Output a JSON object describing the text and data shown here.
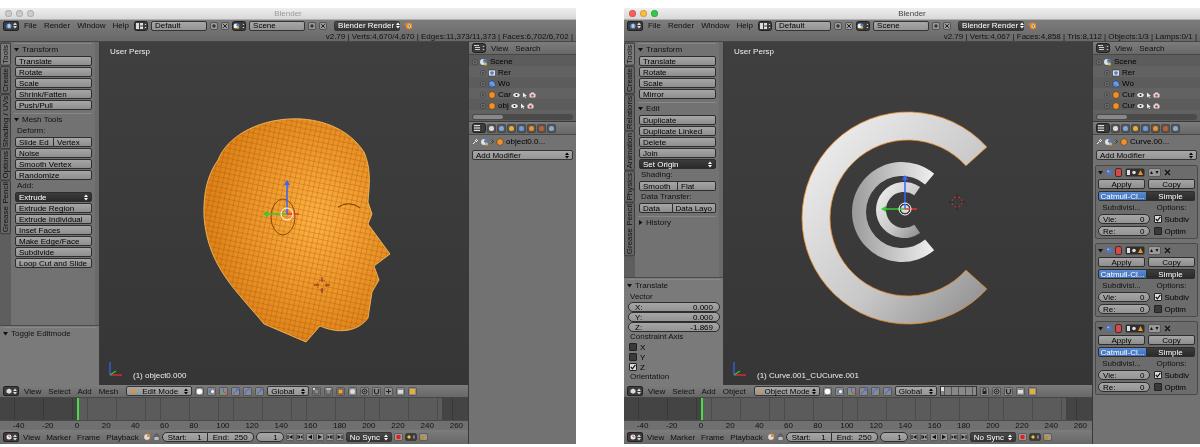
{
  "windows": [
    {
      "title": "Blender",
      "active": false,
      "info_header": {
        "menus": [
          "File",
          "Render",
          "Window",
          "Help"
        ],
        "layout": "Default",
        "scene": "Scene",
        "engine": "Blender Render",
        "stats": "v2.79 | Verts:4,670/4,670 | Edges:11,373/11,373 | Faces:6,702/6,702 |"
      },
      "tool_tabs": [
        {
          "label": "Tools",
          "selected": true
        },
        {
          "label": "Create",
          "selected": false
        },
        {
          "label": "Shading / UVs",
          "selected": false
        },
        {
          "label": "Options",
          "selected": false
        },
        {
          "label": "Grease Pencil",
          "selected": false
        }
      ],
      "tool_panels": [
        {
          "title": "Transform",
          "expanded": true,
          "items": [
            {
              "kind": "button",
              "label": "Translate"
            },
            {
              "kind": "button",
              "label": "Rotate"
            },
            {
              "kind": "button",
              "label": "Scale"
            },
            {
              "kind": "button",
              "label": "Shrink/Fatten"
            },
            {
              "kind": "button",
              "label": "Push/Pull"
            }
          ]
        },
        {
          "title": "Mesh Tools",
          "expanded": true,
          "items": [
            {
              "kind": "label",
              "label": "Deform:"
            },
            {
              "kind": "pair",
              "labels": [
                "Slide Ed",
                "Vertex"
              ]
            },
            {
              "kind": "button",
              "label": "Noise"
            },
            {
              "kind": "button",
              "label": "Smooth Vertex"
            },
            {
              "kind": "button",
              "label": "Randomize"
            },
            {
              "kind": "label",
              "label": "Add:"
            },
            {
              "kind": "dropdown",
              "label": "Extrude"
            },
            {
              "kind": "button",
              "label": "Extrude Region"
            },
            {
              "kind": "button",
              "label": "Extrude Individual"
            },
            {
              "kind": "button",
              "label": "Inset Faces"
            },
            {
              "kind": "button",
              "label": "Make Edge/Face"
            },
            {
              "kind": "button",
              "label": "Subdivide"
            },
            {
              "kind": "button",
              "label": "Loop Cut and Slide"
            }
          ]
        }
      ],
      "operator_panel": {
        "title": "Toggle Editmode",
        "expanded": true
      },
      "viewport": {
        "kind": "mesh",
        "view_name": "User Persp",
        "object_label": "(1) object0.000"
      },
      "outliner": {
        "menus": [
          "View",
          "Search"
        ],
        "items": [
          {
            "label": "Scene",
            "kind": "scene",
            "children": [
              {
                "label": "Rer",
                "kind": "render_layers"
              },
              {
                "label": "Wo",
                "kind": "world"
              },
              {
                "label": "Car",
                "kind": "object"
              },
              {
                "label": "obj",
                "kind": "object"
              }
            ]
          }
        ]
      },
      "properties": {
        "object_name": "object0.0...",
        "add_modifier": "Add Modifier"
      },
      "view3d_header": {
        "menus": [
          "View",
          "Select",
          "Add",
          "Mesh"
        ],
        "mode": "Edit Mode",
        "orientation": "Global"
      },
      "timeline": {
        "ticks": [
          "-40",
          "-20",
          "0",
          "20",
          "40",
          "60",
          "80",
          "100",
          "120",
          "140",
          "160",
          "180",
          "200",
          "220",
          "240",
          "260"
        ]
      },
      "timeline_header": {
        "menus": [
          "View",
          "Marker",
          "Frame",
          "Playback"
        ],
        "start_label": "Start:",
        "start": "1",
        "end_label": "End:",
        "end": "250",
        "frame": "1",
        "sync": "No Sync"
      }
    },
    {
      "title": "Blender",
      "active": true,
      "info_header": {
        "menus": [
          "File",
          "Render",
          "Window",
          "Help"
        ],
        "layout": "Default",
        "scene": "Scene",
        "engine": "Blender Render",
        "stats": "v2.79 | Verts:4,067 | Faces:4,858 | Tris:8,112 | Objects:1/3 | Lamps:0/1 |"
      },
      "tool_tabs": [
        {
          "label": "Tools",
          "selected": true
        },
        {
          "label": "Create",
          "selected": false
        },
        {
          "label": "Relations",
          "selected": false
        },
        {
          "label": "Animation",
          "selected": false
        },
        {
          "label": "Physics",
          "selected": false
        },
        {
          "label": "Grease Pencil",
          "selected": false
        }
      ],
      "tool_panels": [
        {
          "title": "Transform",
          "expanded": true,
          "items": [
            {
              "kind": "button",
              "label": "Translate"
            },
            {
              "kind": "button",
              "label": "Rotate"
            },
            {
              "kind": "button",
              "label": "Scale"
            },
            {
              "kind": "button",
              "label": "Mirror"
            }
          ]
        },
        {
          "title": "Edit",
          "expanded": true,
          "items": [
            {
              "kind": "button",
              "label": "Duplicate"
            },
            {
              "kind": "button",
              "label": "Duplicate Linked"
            },
            {
              "kind": "button",
              "label": "Delete"
            },
            {
              "kind": "button",
              "label": "Join"
            },
            {
              "kind": "dropdown",
              "label": "Set Origin"
            },
            {
              "kind": "label",
              "label": "Shading:"
            },
            {
              "kind": "pair",
              "labels": [
                "Smooth",
                "Flat"
              ]
            },
            {
              "kind": "label",
              "label": "Data Transfer:"
            },
            {
              "kind": "pair",
              "labels": [
                "Data",
                "Data Layo"
              ]
            }
          ]
        },
        {
          "title": "History",
          "expanded": false
        }
      ],
      "operator_panel": {
        "title": "Translate",
        "expanded": true,
        "items": [
          {
            "kind": "label",
            "label": "Vector"
          },
          {
            "kind": "field",
            "label": "X:",
            "value": "0.000"
          },
          {
            "kind": "field",
            "label": "Y:",
            "value": "0.000"
          },
          {
            "kind": "field",
            "label": "Z:",
            "value": "-1.869"
          },
          {
            "kind": "label",
            "label": "Constraint Axis"
          },
          {
            "kind": "checkbox",
            "label": "X",
            "checked": false
          },
          {
            "kind": "checkbox",
            "label": "Y",
            "checked": false
          },
          {
            "kind": "checkbox",
            "label": "Z",
            "checked": true
          },
          {
            "kind": "label",
            "label": "Orientation"
          }
        ]
      },
      "viewport": {
        "kind": "curves",
        "view_name": "User Persp",
        "object_label": "(1) Curve.001_CUCurve.001"
      },
      "outliner": {
        "menus": [
          "View",
          "Search"
        ],
        "items": [
          {
            "label": "Scene",
            "kind": "scene",
            "children": [
              {
                "label": "Rer",
                "kind": "render_layers"
              },
              {
                "label": "Wo",
                "kind": "world"
              },
              {
                "label": "Cur",
                "kind": "object"
              },
              {
                "label": "Cur",
                "kind": "object"
              }
            ]
          }
        ]
      },
      "properties": {
        "object_name": "Curve.00...",
        "add_modifier": "Add Modifier",
        "modifiers": [
          {
            "expanded": true,
            "apply": "Apply",
            "copy": "Copy",
            "subdivision_types": [
              {
                "label": "Catmull-Cl...",
                "selected": true
              },
              {
                "label": "Simple",
                "selected": false
              }
            ],
            "subdivisions_label": "Subdivisi...",
            "options_label": "Options:",
            "levels": [
              {
                "label": "Vie:",
                "value": "0"
              },
              {
                "label": "Re:",
                "value": "0"
              }
            ],
            "options": [
              {
                "label": "Subdiv",
                "checked": true
              },
              {
                "label": "Optim",
                "checked": false
              }
            ]
          },
          {
            "expanded": true,
            "apply": "Apply",
            "copy": "Copy",
            "subdivision_types": [
              {
                "label": "Catmull-Cl...",
                "selected": true
              },
              {
                "label": "Simple",
                "selected": false
              }
            ],
            "subdivisions_label": "Subdivisi...",
            "options_label": "Options:",
            "levels": [
              {
                "label": "Vie:",
                "value": "0"
              },
              {
                "label": "Re:",
                "value": "0"
              }
            ],
            "options": [
              {
                "label": "Subdiv",
                "checked": true
              },
              {
                "label": "Optim",
                "checked": false
              }
            ]
          },
          {
            "expanded": true,
            "apply": "Apply",
            "copy": "Copy",
            "subdivision_types": [
              {
                "label": "Catmull-Cl...",
                "selected": true
              },
              {
                "label": "Simple",
                "selected": false
              }
            ],
            "subdivisions_label": "Subdivisi...",
            "options_label": "Options:",
            "levels": [
              {
                "label": "Vie:",
                "value": "0"
              },
              {
                "label": "Re:",
                "value": "0"
              }
            ],
            "options": [
              {
                "label": "Subdiv",
                "checked": true
              },
              {
                "label": "Optim",
                "checked": false
              }
            ]
          }
        ]
      },
      "view3d_header": {
        "menus": [
          "View",
          "Select",
          "Add",
          "Object"
        ],
        "mode": "Object Mode",
        "orientation": "Global"
      },
      "timeline": {
        "ticks": [
          "-40",
          "-20",
          "0",
          "20",
          "40",
          "60",
          "80",
          "100",
          "120",
          "140",
          "160",
          "180",
          "200",
          "220",
          "240",
          "260"
        ]
      },
      "timeline_header": {
        "menus": [
          "View",
          "Marker",
          "Frame",
          "Playback"
        ],
        "start_label": "Start:",
        "start": "1",
        "end_label": "End:",
        "end": "250",
        "frame": "1",
        "sync": "No Sync"
      }
    }
  ]
}
